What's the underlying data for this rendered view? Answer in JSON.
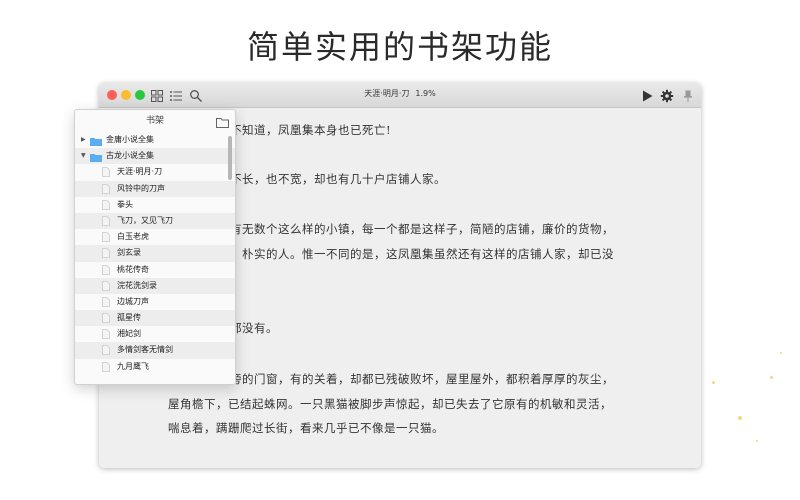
{
  "headline": "简单实用的书架功能",
  "window": {
    "title": "天涯·明月·刀",
    "progress": "1.9%",
    "toolbar_icons": [
      "grid-icon",
      "list-icon",
      "search-icon",
      "play-icon",
      "gear-icon",
      "pin-icon"
    ]
  },
  "content_lines": [
    "不知道，凤凰集本身也已死亡!",
    "不长，也不宽，却也有几十户店铺人家。",
    "有无数个这么样的小镇，每一个都是这样子，简陋的店铺，廉价的货物，",
    "朴实的人。惟一不同的是，这凤凰集虽然还有这样的店铺人家，却已没",
    "都没有。",
    "旁的门窗，有的关着，却都已残破败坏，屋里屋外，都积着厚厚的灰尘，",
    "屋角檐下，已结起蛛网。一只黑猫被脚步声惊起，却已失去了它原有的机敏和灵活，",
    "喘息着，蹒跚爬过长街，看来几乎已不像是一只猫。"
  ],
  "bookshelf": {
    "title": "书架",
    "folders": [
      {
        "label": "金庸小说全集",
        "expanded": false
      },
      {
        "label": "古龙小说全集",
        "expanded": true
      }
    ],
    "books": [
      "天涯·明月·刀",
      "风铃中的刀声",
      "拳头",
      "飞刀，又见飞刀",
      "白玉老虎",
      "剑玄录",
      "桃花传奇",
      "浣花洗剑录",
      "边城刀声",
      "孤星传",
      "湘妃剑",
      "多情剑客无情剑",
      "九月鹰飞"
    ]
  },
  "colors": {
    "close": "#fc5f57",
    "minimize": "#fdbb2e",
    "zoom": "#29c840",
    "folder": "#5aaef0",
    "page_background": "#efefef"
  }
}
